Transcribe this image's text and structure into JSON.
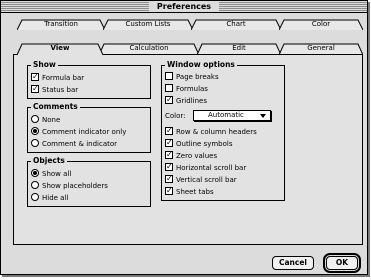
{
  "window": {
    "title": "Preferences"
  },
  "tabs_back": [
    {
      "label": "Transition"
    },
    {
      "label": "Custom Lists"
    },
    {
      "label": "Chart"
    },
    {
      "label": "Color"
    }
  ],
  "tabs_front": [
    {
      "label": "View"
    },
    {
      "label": "Calculation"
    },
    {
      "label": "Edit"
    },
    {
      "label": "General"
    }
  ],
  "active_tab": "View",
  "show": {
    "title": "Show",
    "items": [
      {
        "label": "Formula bar",
        "checked": true
      },
      {
        "label": "Status bar",
        "checked": true
      }
    ]
  },
  "comments": {
    "title": "Comments",
    "options": [
      {
        "label": "None",
        "selected": false
      },
      {
        "label": "Comment indicator only",
        "selected": true
      },
      {
        "label": "Comment & indicator",
        "selected": false
      }
    ]
  },
  "objects": {
    "title": "Objects",
    "options": [
      {
        "label": "Show all",
        "selected": true
      },
      {
        "label": "Show placeholders",
        "selected": false
      },
      {
        "label": "Hide all",
        "selected": false
      }
    ]
  },
  "window_options": {
    "title": "Window options",
    "items_top": [
      {
        "label": "Page breaks",
        "checked": false
      },
      {
        "label": "Formulas",
        "checked": false
      },
      {
        "label": "Gridlines",
        "checked": true
      }
    ],
    "color_label": "Color:",
    "color_value": "Automatic",
    "items_bottom": [
      {
        "label": "Row & column headers",
        "checked": true
      },
      {
        "label": "Outline symbols",
        "checked": true
      },
      {
        "label": "Zero values",
        "checked": true
      },
      {
        "label": "Horizontal scroll bar",
        "checked": true
      },
      {
        "label": "Vertical scroll bar",
        "checked": true
      },
      {
        "label": "Sheet tabs",
        "checked": true
      }
    ]
  },
  "buttons": {
    "cancel": "Cancel",
    "ok": "OK"
  },
  "colors": {
    "window_bg": "#dcdcdc",
    "panel_bg": "#e2e2e2",
    "border": "#000000"
  }
}
